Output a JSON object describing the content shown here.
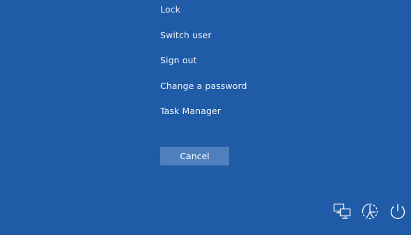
{
  "security_options": {
    "items": [
      {
        "id": "lock",
        "label": "Lock"
      },
      {
        "id": "switch-user",
        "label": "Switch user"
      },
      {
        "id": "sign-out",
        "label": "Sign out"
      },
      {
        "id": "change-password",
        "label": "Change a password"
      },
      {
        "id": "task-manager",
        "label": "Task Manager"
      }
    ],
    "cancel_label": "Cancel"
  },
  "tray": {
    "icons": [
      "network-icon",
      "accessibility-icon",
      "power-icon"
    ]
  },
  "colors": {
    "background": "#1f5ba7",
    "button": "#4f80bd",
    "text": "#ffffff"
  }
}
